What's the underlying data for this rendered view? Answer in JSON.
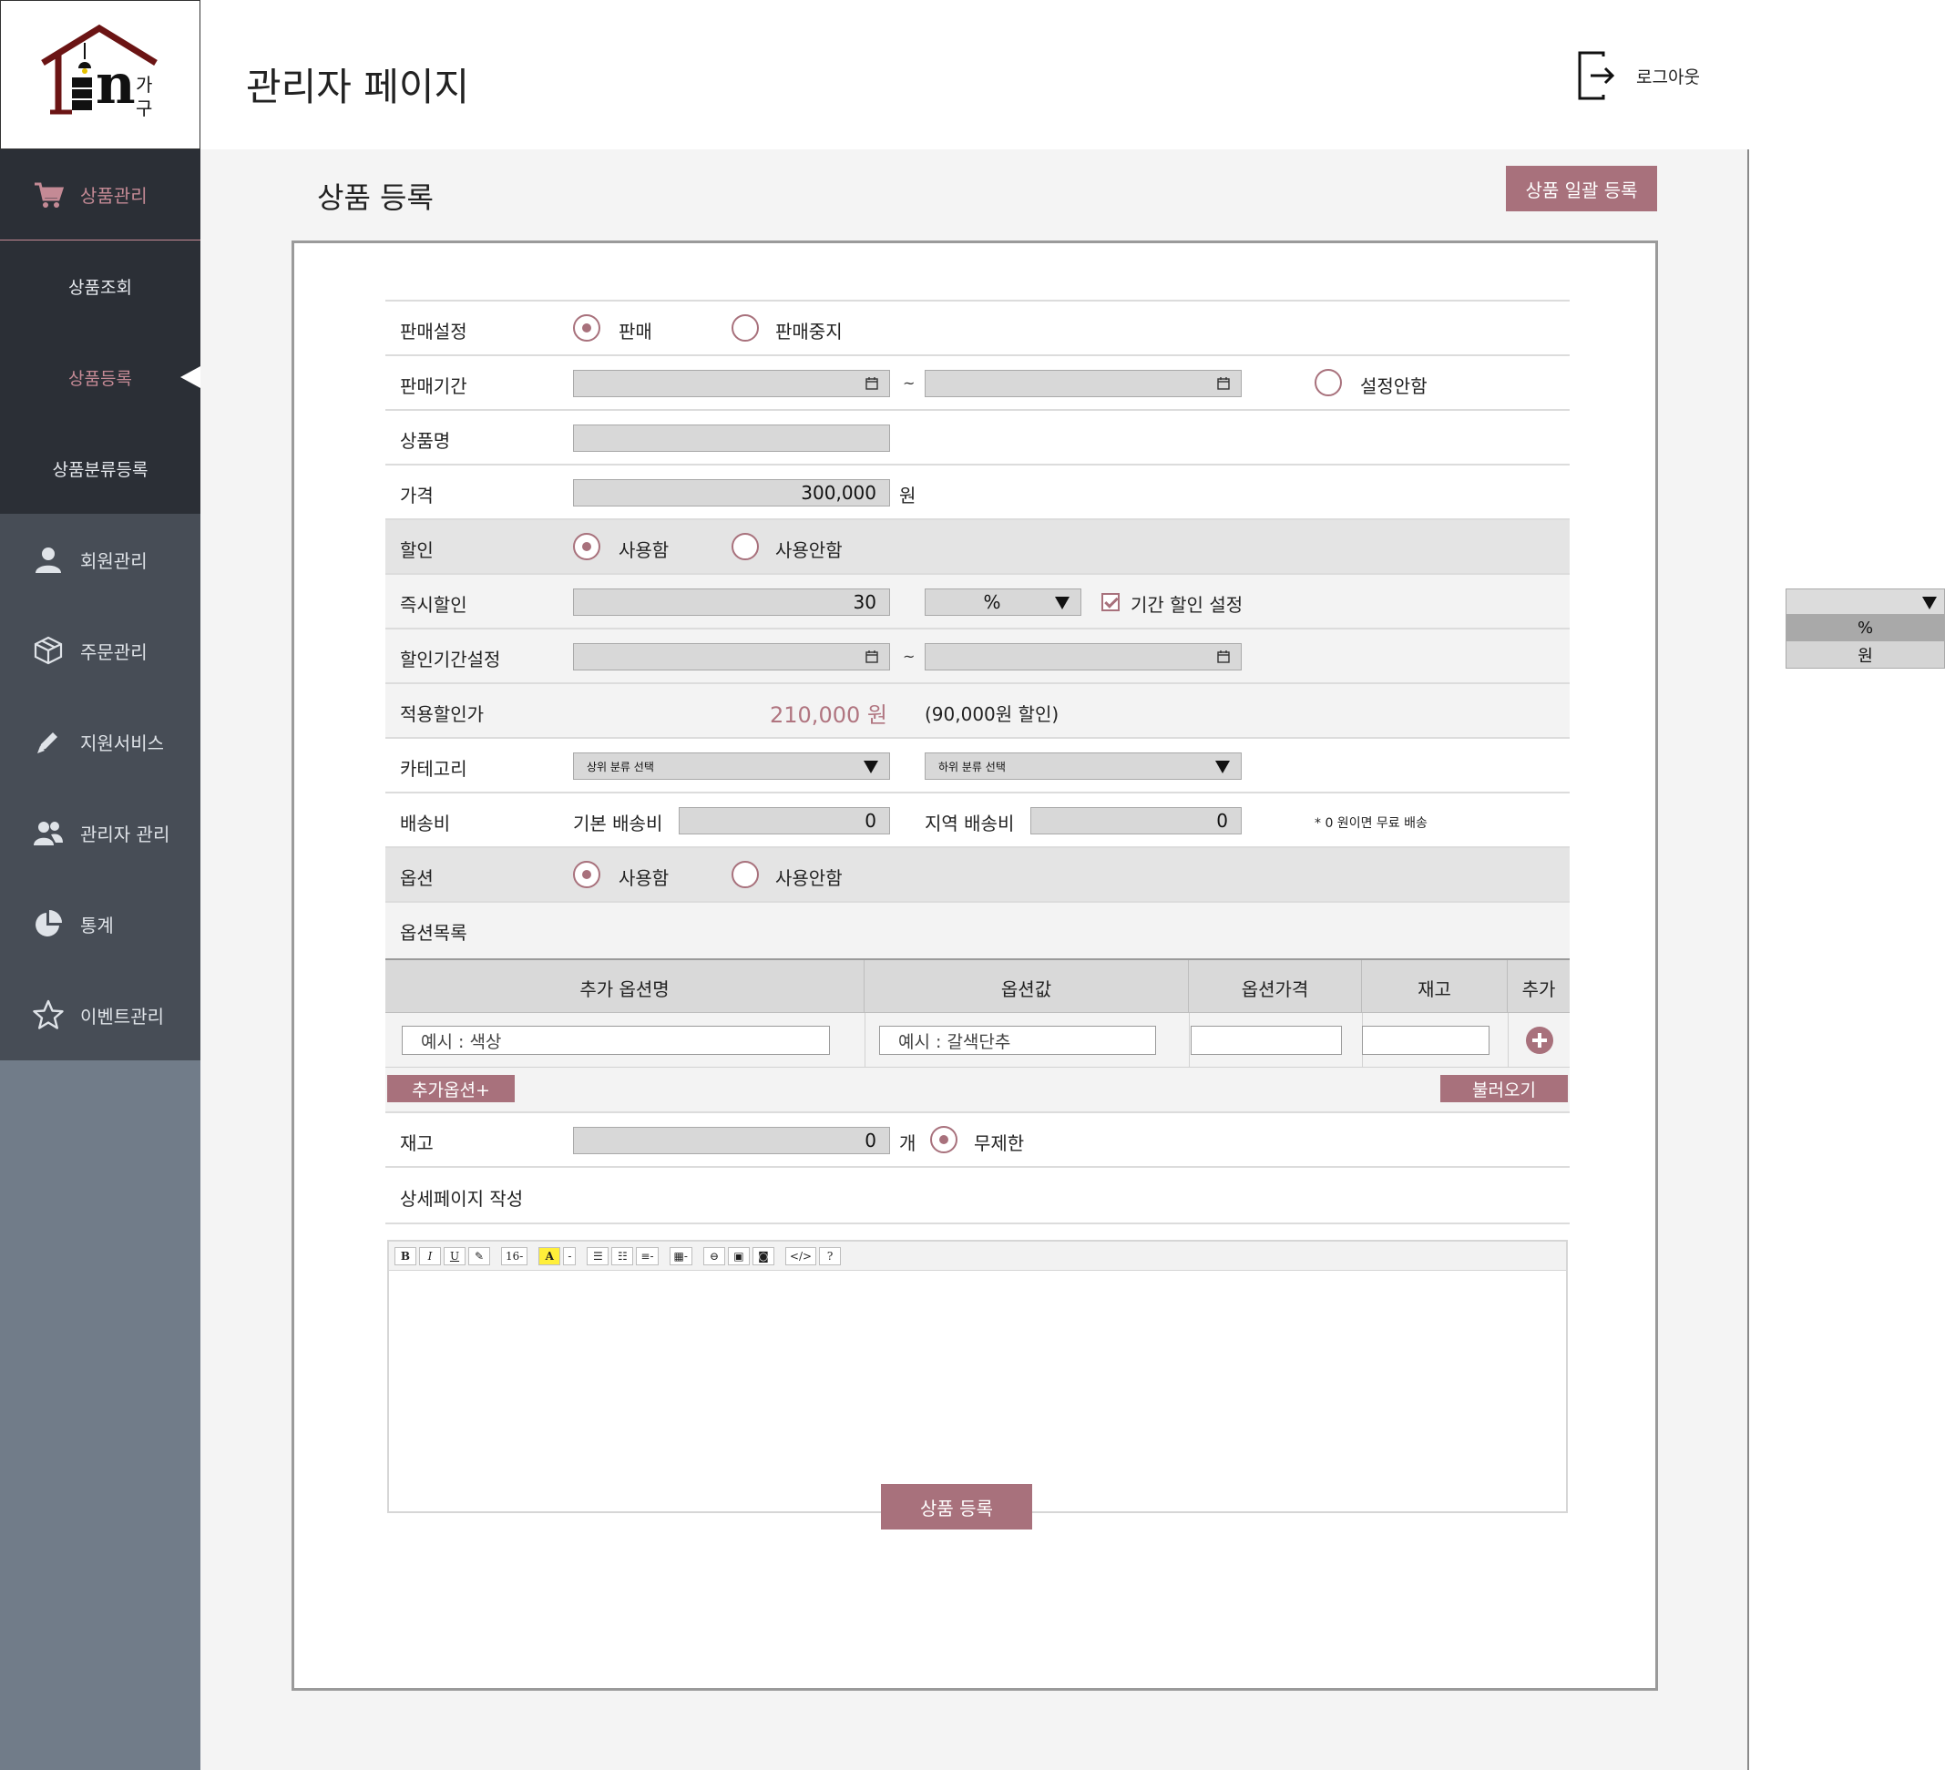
{
  "header": {
    "logo_text_main": "n",
    "logo_text_ga": "가",
    "logo_text_gu": "구",
    "title": "관리자 페이지",
    "logout_label": "로그아웃"
  },
  "sidebar": {
    "items": [
      {
        "label": "상품관리",
        "icon": "cart-icon",
        "active": true
      },
      {
        "label": "회원관리",
        "icon": "user-icon"
      },
      {
        "label": "주문관리",
        "icon": "box-icon"
      },
      {
        "label": "지원서비스",
        "icon": "pencil-icon"
      },
      {
        "label": "관리자 관리",
        "icon": "users-icon"
      },
      {
        "label": "통계",
        "icon": "pie-chart-icon"
      },
      {
        "label": "이벤트관리",
        "icon": "star-icon"
      }
    ],
    "sub_items": [
      {
        "label": "상품조회"
      },
      {
        "label": "상품등록",
        "active": true
      },
      {
        "label": "상품분류등록"
      }
    ]
  },
  "main": {
    "title": "상품 등록",
    "bulk_button": "상품 일괄 등록",
    "submit_button": "상품 등록"
  },
  "form": {
    "sale_setting": {
      "label": "판매설정",
      "opt_on": "판매",
      "opt_off": "판매중지"
    },
    "sale_period": {
      "label": "판매기간",
      "tilde": "~",
      "no_set": "설정안함"
    },
    "product_name": {
      "label": "상품명",
      "value": ""
    },
    "price": {
      "label": "가격",
      "value": "300,000",
      "unit": "원"
    },
    "discount": {
      "label": "할인",
      "opt_on": "사용함",
      "opt_off": "사용안함"
    },
    "instant_discount": {
      "label": "즉시할인",
      "value": "30",
      "unit_select": "%",
      "period_check": "기간 할인 설정"
    },
    "discount_period": {
      "label": "할인기간설정",
      "tilde": "~"
    },
    "applied_price": {
      "label": "적용할인가",
      "value": "210,000 원",
      "note": "(90,000원 할인)"
    },
    "category": {
      "label": "카테고리",
      "upper": "상위 분류 선택",
      "lower": "하위 분류 선택"
    },
    "shipping": {
      "label": "배송비",
      "basic_label": "기본 배송비",
      "basic_value": "0",
      "region_label": "지역 배송비",
      "region_value": "0",
      "note": "* 0 원이면 무료 배송"
    },
    "option": {
      "label": "옵션",
      "opt_on": "사용함",
      "opt_off": "사용안함"
    },
    "option_list": {
      "label": "옵션목록"
    },
    "option_table": {
      "headers": [
        "추가 옵션명",
        "옵션값",
        "옵션가격",
        "재고",
        "추가"
      ],
      "name_placeholder": "예시 : 색상",
      "value_placeholder": "예시 : 갈색단추",
      "add_option_button": "추가옵션+",
      "load_button": "불러오기"
    },
    "stock": {
      "label": "재고",
      "value": "0",
      "unit": "개",
      "unlimited": "무제한"
    },
    "detail": {
      "label": "상세페이지 작성"
    },
    "editor_toolbar": [
      "B",
      "I",
      "U",
      "✎",
      "16-",
      "A",
      "-",
      "☰",
      "☷",
      "≡-",
      "▦-",
      "⊖",
      "▣",
      "◙",
      "</>",
      "?"
    ]
  },
  "floating_dropdown": {
    "options": [
      "%",
      "원"
    ],
    "selected": "%"
  },
  "colors": {
    "accent": "#a8717c",
    "sidebar_dark": "#2b2f36",
    "sidebar_mid": "#474d56",
    "sidebar_bottom": "#717c89"
  }
}
